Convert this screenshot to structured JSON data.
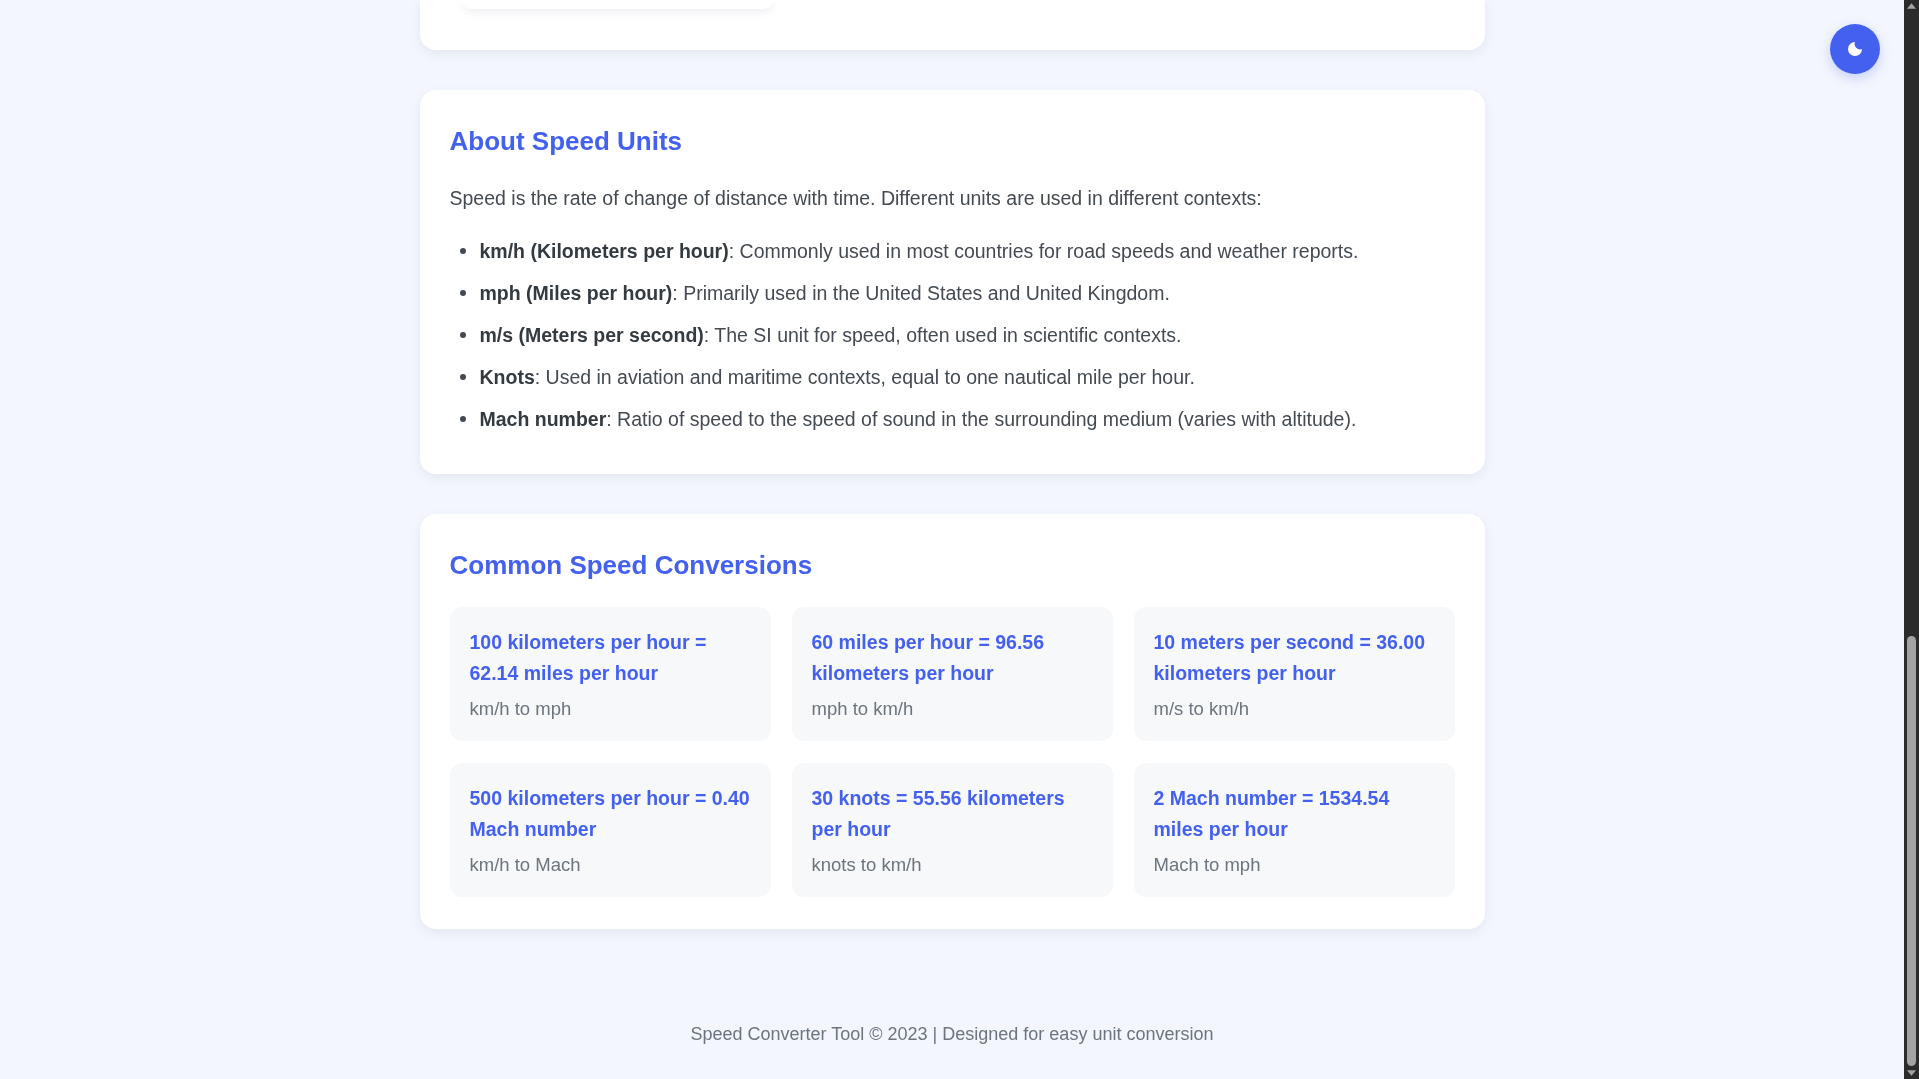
{
  "about": {
    "title": "About Speed Units",
    "intro": "Speed is the rate of change of distance with time. Different units are used in different contexts:",
    "items": [
      "**km/h (Kilometers per hour)**: Commonly used in most countries for road speeds and weather reports.",
      "**mph (Miles per hour)**: Primarily used in the United States and United Kingdom.",
      "**m/s (Meters per second)**: The SI unit for speed, often used in scientific contexts.",
      "**Knots**: Used in aviation and maritime contexts, equal to one nautical mile per hour.",
      "**Mach number**: Ratio of speed to the speed of sound in the surrounding medium (varies with altitude)."
    ]
  },
  "conversions": {
    "title": "Common Speed Conversions",
    "items": [
      {
        "result": "100 kilometers per hour = 62.14 miles per hour",
        "label": "km/h to mph"
      },
      {
        "result": "60 miles per hour = 96.56 kilometers per hour",
        "label": "mph to km/h"
      },
      {
        "result": "10 meters per second = 36.00 kilometers per hour",
        "label": "m/s to km/h"
      },
      {
        "result": "500 kilometers per hour = 0.40 Mach number",
        "label": "km/h to Mach"
      },
      {
        "result": "30 knots = 55.56 kilometers per hour",
        "label": "knots to km/h"
      },
      {
        "result": "2 Mach number = 1534.54 miles per hour",
        "label": "Mach to mph"
      }
    ]
  },
  "footer": {
    "text": "Speed Converter Tool © 2023 | Designed for easy unit conversion"
  }
}
